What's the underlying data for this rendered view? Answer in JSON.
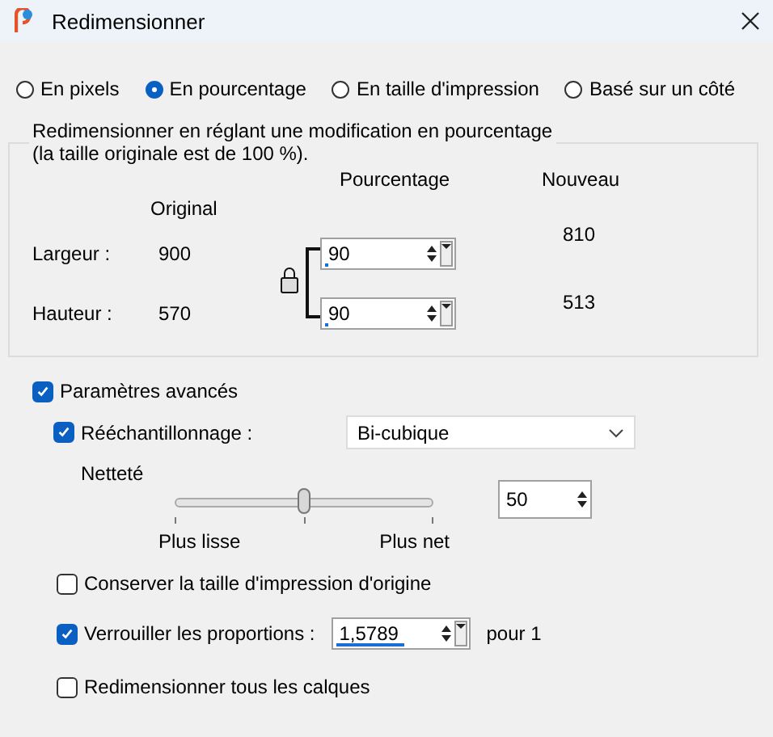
{
  "window": {
    "title": "Redimensionner"
  },
  "modes": [
    {
      "label": "En pixels",
      "selected": false
    },
    {
      "label": "En pourcentage",
      "selected": true
    },
    {
      "label": "En taille d'impression",
      "selected": false
    },
    {
      "label": "Basé sur un côté",
      "selected": false
    }
  ],
  "group": {
    "legend": "Redimensionner en réglant une modification en pourcentage\n(la taille originale est de 100 %).",
    "headers": {
      "original": "Original",
      "percent": "Pourcentage",
      "new": "Nouveau"
    },
    "rows": [
      {
        "label": "Largeur :",
        "original": "900",
        "percent": "90",
        "level": 0.02,
        "new": "810"
      },
      {
        "label": "Hauteur :",
        "original": "570",
        "percent": "90",
        "level": 0.02,
        "new": "513"
      }
    ],
    "locked": true
  },
  "advanced": {
    "label": "Paramètres avancés",
    "checked": true
  },
  "resample": {
    "label": "Rééchantillonnage :",
    "checked": true,
    "value": "Bi-cubique"
  },
  "sharpness": {
    "label": "Netteté",
    "level": 0.5,
    "min_label": "Plus lisse",
    "max_label": "Plus net",
    "value": "50"
  },
  "keep_print": {
    "label": "Conserver la taille d'impression d'origine",
    "checked": false
  },
  "lock_ratio": {
    "label": "Verrouiller les proportions :",
    "checked": true,
    "value": "1,5789",
    "level": 0.5,
    "suffix": "pour 1"
  },
  "all_layers": {
    "label": "Redimensionner tous les calques",
    "checked": false
  }
}
